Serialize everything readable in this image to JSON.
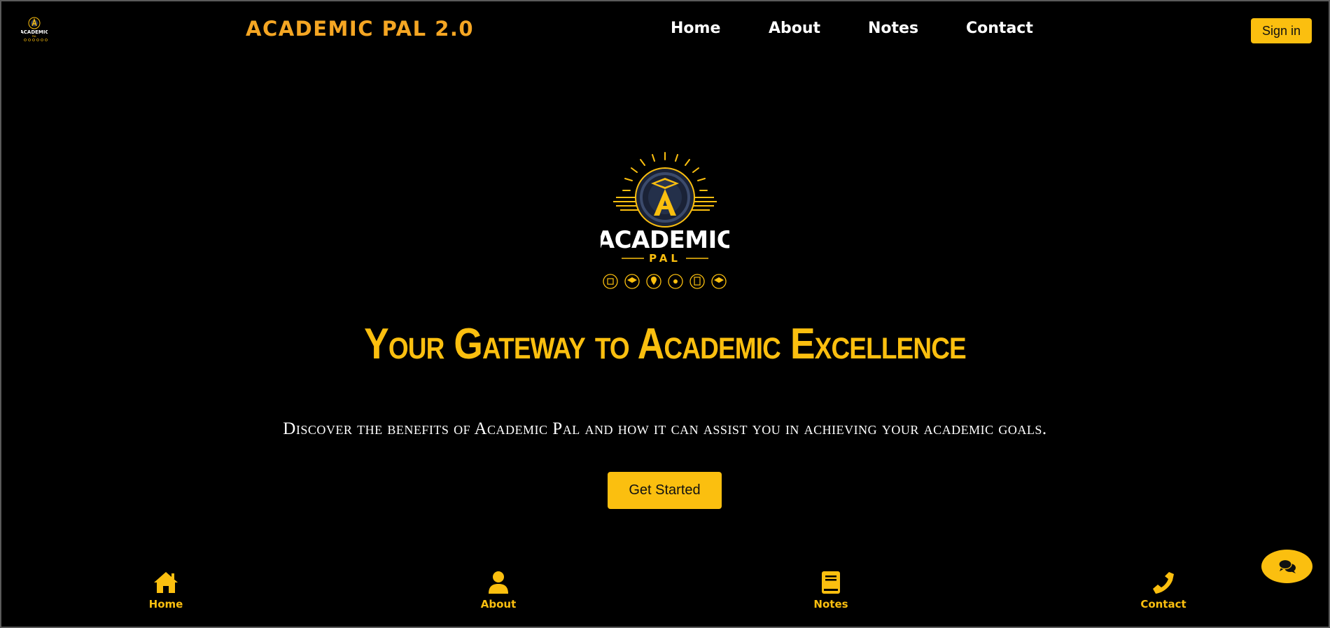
{
  "colors": {
    "accent": "#fbbf0f",
    "brand_orange": "#f5a623",
    "background": "#000000",
    "text": "#ffffff"
  },
  "header": {
    "brand": "ACADEMIC PAL 2.0",
    "logo_icon": "academic-pal-logo",
    "nav": [
      "Home",
      "About",
      "Notes",
      "Contact"
    ],
    "sign_in": "Sign in"
  },
  "hero": {
    "logo": {
      "icon": "academic-pal-logo",
      "line1": "ACADEMIC",
      "line2": "PAL"
    },
    "headline": "Your Gateway to Academic Excellence",
    "subtitle": "Discover the benefits of Academic Pal and how it can assist you in achieving your academic goals.",
    "cta": "Get Started"
  },
  "chat": {
    "icon": "comments-icon"
  },
  "bottom_nav": [
    {
      "label": "Home",
      "icon": "home-icon"
    },
    {
      "label": "About",
      "icon": "user-icon"
    },
    {
      "label": "Notes",
      "icon": "book-icon"
    },
    {
      "label": "Contact",
      "icon": "phone-icon"
    }
  ]
}
